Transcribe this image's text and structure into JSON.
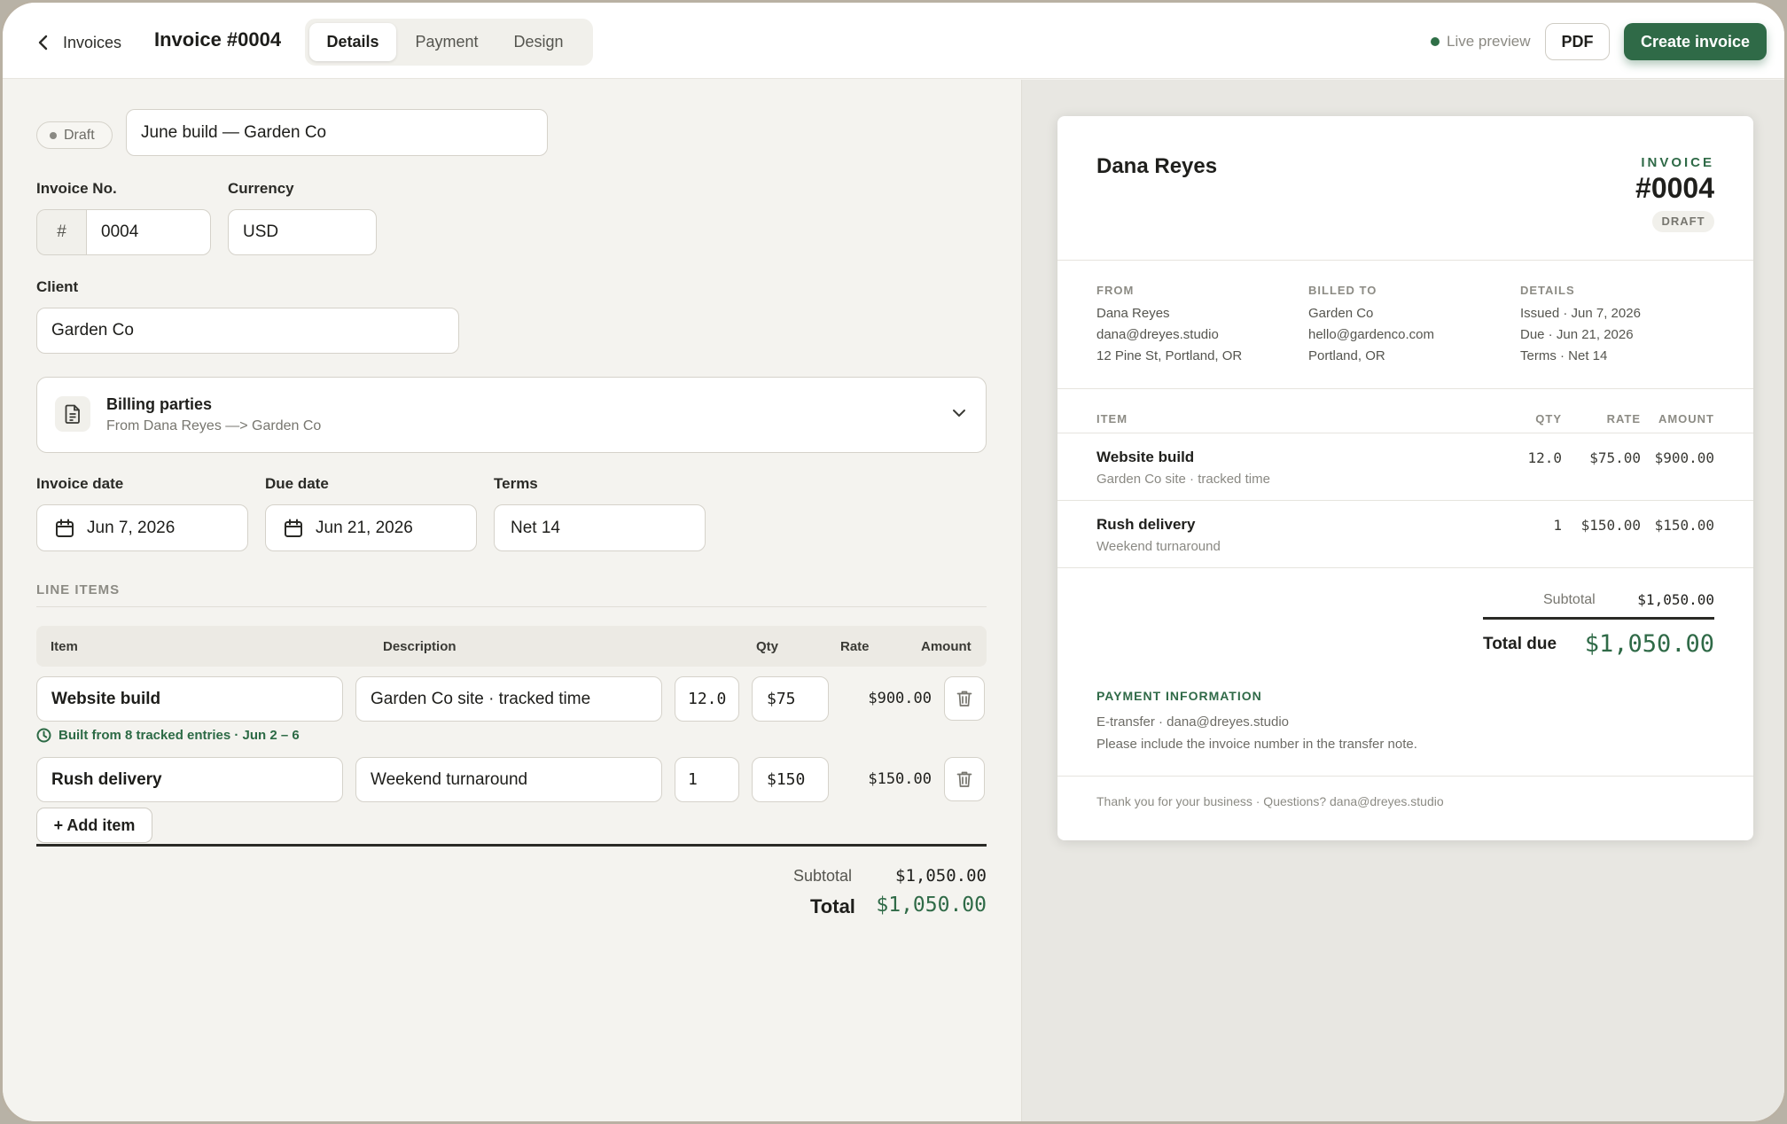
{
  "topbar": {
    "back_label": "Invoices",
    "title": "Invoice #0004",
    "tabs": [
      {
        "label": "Details"
      },
      {
        "label": "Payment"
      },
      {
        "label": "Design"
      }
    ],
    "active_tab": "Details",
    "live_preview": "Live preview",
    "pdf_label": "PDF",
    "create_label": "Create invoice"
  },
  "form": {
    "status": "Draft",
    "invoice_name": "June build — Garden Co",
    "invoice_no_label": "Invoice No.",
    "invoice_no_prefix": "#",
    "invoice_no": "0004",
    "currency_label": "Currency",
    "currency": "USD",
    "client_label": "Client",
    "client": "Garden Co",
    "billing_title": "Billing parties",
    "billing_sub": "From Dana Reyes —> Garden Co",
    "invoice_date_label": "Invoice date",
    "invoice_date": "Jun 7, 2026",
    "due_date_label": "Due date",
    "due_date": "Jun 21, 2026",
    "terms_label": "Terms",
    "terms": "Net 14",
    "line_items_title": "LINE ITEMS",
    "columns": {
      "item": "Item",
      "description": "Description",
      "qty": "Qty",
      "rate": "Rate",
      "amount": "Amount"
    },
    "line_items": [
      {
        "item": "Website build",
        "description": "Garden Co site · tracked time",
        "qty": "12.0",
        "rate": "$75",
        "amount": "$900.00"
      },
      {
        "item": "Rush delivery",
        "description": "Weekend turnaround",
        "qty": "1",
        "rate": "$150",
        "amount": "$150.00"
      }
    ],
    "tracked_note": "Built from 8 tracked entries · Jun 2 – 6",
    "add_item": "+ Add item",
    "subtotal_label": "Subtotal",
    "subtotal": "$1,050.00",
    "total_label": "Total",
    "total": "$1,050.00"
  },
  "preview": {
    "name": "Dana Reyes",
    "invoice_label": "INVOICE",
    "invoice_no": "#0004",
    "status": "DRAFT",
    "from_label": "FROM",
    "from_lines": [
      "Dana Reyes",
      "dana@dreyes.studio",
      "12 Pine St, Portland, OR"
    ],
    "billed_label": "BILLED TO",
    "billed_lines": [
      "Garden Co",
      "hello@gardenco.com",
      "Portland, OR"
    ],
    "details_label": "DETAILS",
    "details_lines": [
      "Issued · Jun 7, 2026",
      "Due · Jun 21, 2026",
      "Terms · Net 14"
    ],
    "cols": {
      "item": "ITEM",
      "qty": "QTY",
      "rate": "RATE",
      "amount": "AMOUNT"
    },
    "items": [
      {
        "name": "Website build",
        "sub": "Garden Co site · tracked time",
        "qty": "12.0",
        "rate": "$75.00",
        "amount": "$900.00"
      },
      {
        "name": "Rush delivery",
        "sub": "Weekend turnaround",
        "qty": "1",
        "rate": "$150.00",
        "amount": "$150.00"
      }
    ],
    "subtotal_label": "Subtotal",
    "subtotal": "$1,050.00",
    "total_label": "Total due",
    "total": "$1,050.00",
    "payment_title": "PAYMENT INFORMATION",
    "payment_line1": "E-transfer · dana@dreyes.studio",
    "payment_line2": "Please include the invoice number in the transfer note.",
    "footer": "Thank you for your business · Questions? dana@dreyes.studio"
  },
  "colors": {
    "accent": "#2f6a47",
    "background": "#f4f3ef",
    "preview_bg": "#e8e7e2"
  },
  "icons": [
    "chevron-left-icon",
    "document-icon",
    "chevron-down-icon",
    "calendar-icon",
    "clock-icon",
    "trash-icon"
  ]
}
